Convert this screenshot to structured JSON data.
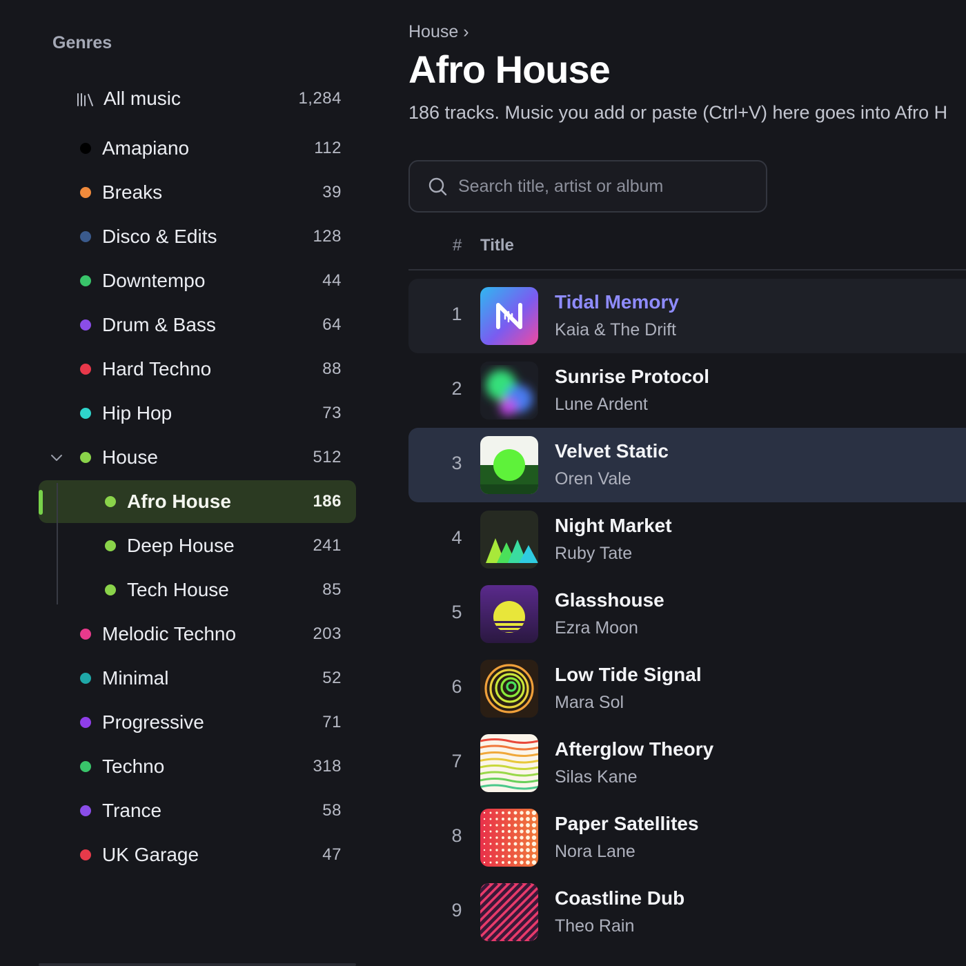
{
  "sidebar": {
    "title": "Genres",
    "all_music": {
      "label": "All music",
      "count": "1,284"
    },
    "genres": [
      {
        "label": "Amapiano",
        "count": "112",
        "color": "#000000"
      },
      {
        "label": "Breaks",
        "count": "39",
        "color": "#f08a3c"
      },
      {
        "label": "Disco & Edits",
        "count": "128",
        "color": "#3a5a8c"
      },
      {
        "label": "Downtempo",
        "count": "44",
        "color": "#39c46a"
      },
      {
        "label": "Drum & Bass",
        "count": "64",
        "color": "#8a4de8"
      },
      {
        "label": "Hard Techno",
        "count": "88",
        "color": "#e8384a"
      },
      {
        "label": "Hip Hop",
        "count": "73",
        "color": "#2fd4cc"
      },
      {
        "label": "House",
        "count": "512",
        "color": "#8ad34a",
        "expanded": true
      },
      {
        "label": "Melodic Techno",
        "count": "203",
        "color": "#e83a8c"
      },
      {
        "label": "Minimal",
        "count": "52",
        "color": "#1fa8a8"
      },
      {
        "label": "Progressive",
        "count": "71",
        "color": "#8f3ee8"
      },
      {
        "label": "Techno",
        "count": "318",
        "color": "#39c46a"
      },
      {
        "label": "Trance",
        "count": "58",
        "color": "#8a4de8"
      },
      {
        "label": "UK Garage",
        "count": "47",
        "color": "#e83a4a"
      }
    ],
    "house_children": [
      {
        "label": "Afro House",
        "count": "186",
        "color": "#8ad34a",
        "selected": true
      },
      {
        "label": "Deep House",
        "count": "241",
        "color": "#8ad34a"
      },
      {
        "label": "Tech House",
        "count": "85",
        "color": "#8ad34a"
      }
    ]
  },
  "main": {
    "breadcrumb": "House ›",
    "title": "Afro House",
    "subtitle": "186 tracks. Music you add or paste (Ctrl+V) here goes into Afro H",
    "search_placeholder": "Search title, artist or album",
    "columns": {
      "num": "#",
      "title": "Title"
    },
    "tracks": [
      {
        "num": "1",
        "title": "Tidal Memory",
        "artist": "Kaia & The Drift",
        "art": "app-logo",
        "state": "playing"
      },
      {
        "num": "2",
        "title": "Sunrise Protocol",
        "artist": "Lune Ardent",
        "art": "blur-blobs"
      },
      {
        "num": "3",
        "title": "Velvet Static",
        "artist": "Oren Vale",
        "art": "green-sun",
        "state": "selected"
      },
      {
        "num": "4",
        "title": "Night Market",
        "artist": "Ruby Tate",
        "art": "peaks"
      },
      {
        "num": "5",
        "title": "Glasshouse",
        "artist": "Ezra Moon",
        "art": "striped-sun"
      },
      {
        "num": "6",
        "title": "Low Tide Signal",
        "artist": "Mara Sol",
        "art": "spiral"
      },
      {
        "num": "7",
        "title": "Afterglow Theory",
        "artist": "Silas Kane",
        "art": "waves"
      },
      {
        "num": "8",
        "title": "Paper Satellites",
        "artist": "Nora Lane",
        "art": "dot-grid"
      },
      {
        "num": "9",
        "title": "Coastline Dub",
        "artist": "Theo Rain",
        "art": "diagonal-stripes"
      }
    ]
  }
}
